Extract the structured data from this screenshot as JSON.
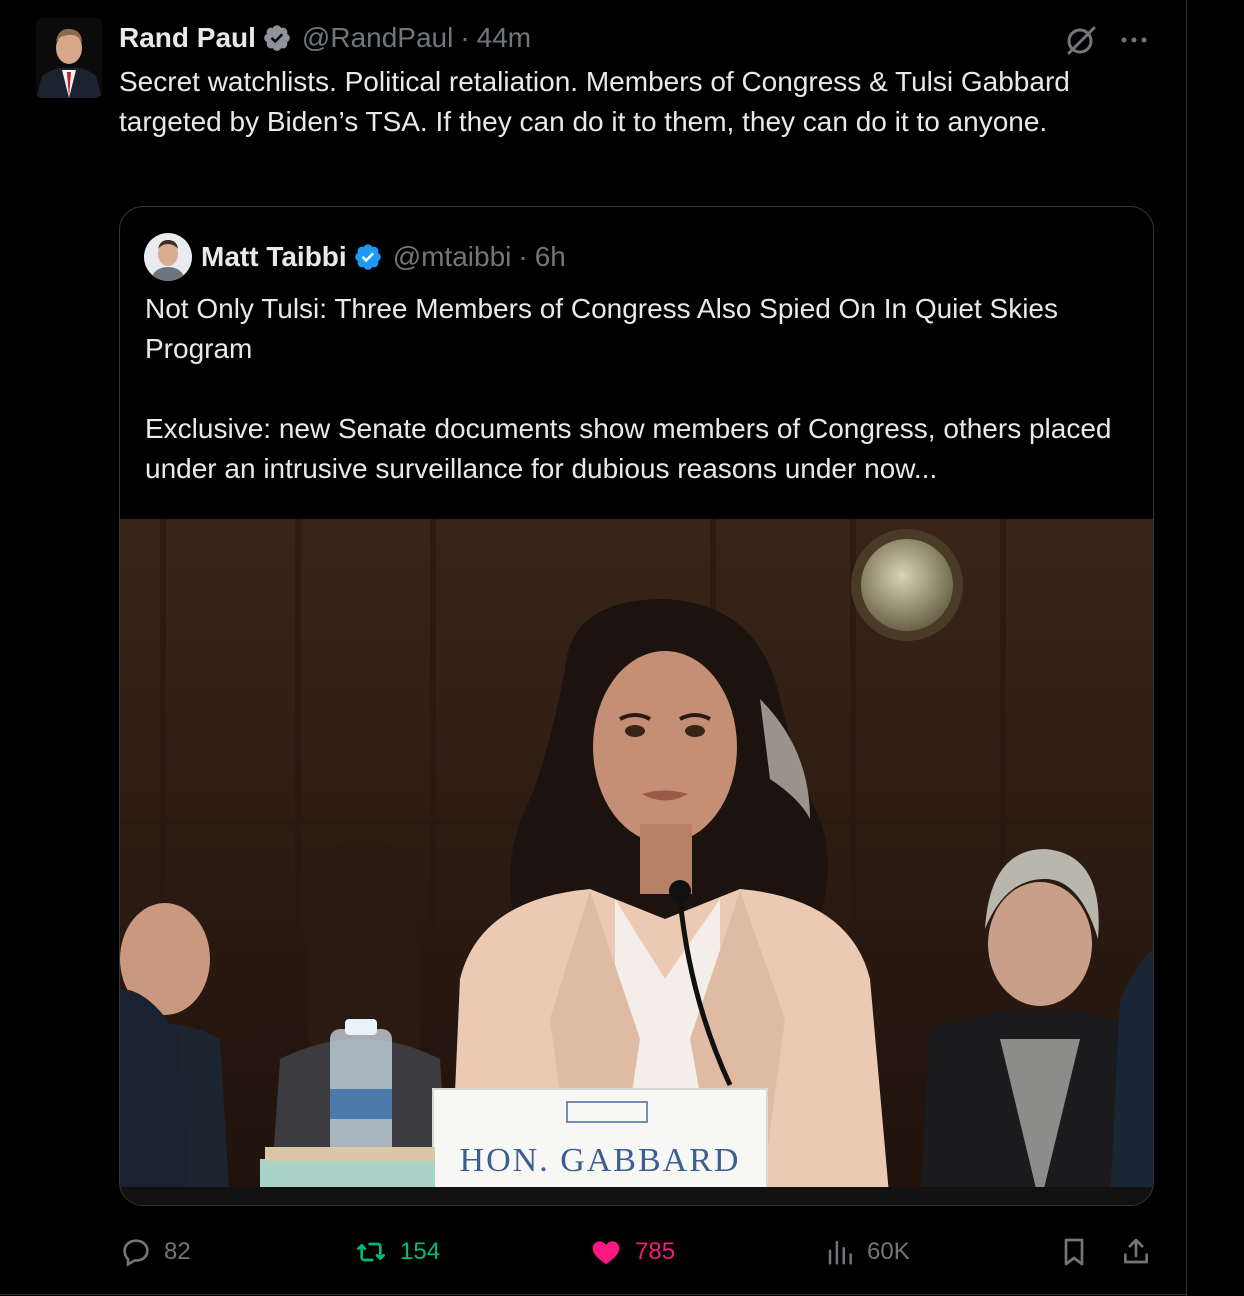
{
  "post": {
    "author_name": "Rand Paul",
    "handle": "@RandPaul",
    "separator": "·",
    "time": "44m",
    "text": "Secret watchlists. Political retaliation. Members of Congress & Tulsi Gabbard targeted by Biden’s TSA. If they can do it to them, they can do it to anyone."
  },
  "quoted": {
    "author_name": "Matt Taibbi",
    "handle": "@mtaibbi",
    "separator": "·",
    "time": "6h",
    "title": "Not Only Tulsi: Three Members of Congress Also Spied On In Quiet Skies Program",
    "description": "Exclusive: new Senate documents show members of Congress, others placed under an intrusive surveillance for dubious reasons under now...",
    "image": {
      "nameplate": "HON. GABBARD"
    }
  },
  "actions": {
    "replies": "82",
    "reposts": "154",
    "likes": "785",
    "views": "60K"
  },
  "colors": {
    "background": "#000000",
    "text_primary": "#e7e9ea",
    "text_secondary": "#71767b",
    "verified": "#1d9bf0",
    "repost_active": "#00ba7c",
    "like_active": "#f91880"
  },
  "icons": [
    "verified-badge-icon",
    "grok-icon",
    "more-icon",
    "reply-icon",
    "repost-icon",
    "like-icon",
    "views-icon",
    "bookmark-icon",
    "share-icon"
  ]
}
